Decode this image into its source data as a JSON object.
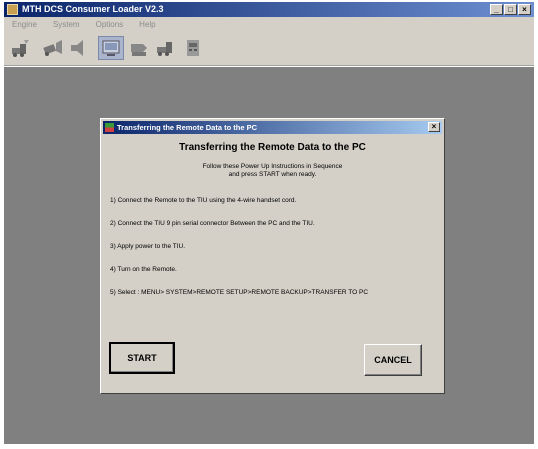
{
  "app": {
    "title": "MTH DCS Consumer Loader V2.3",
    "window_controls": [
      "_",
      "□",
      "×"
    ]
  },
  "menu": {
    "items": [
      "Engine",
      "System",
      "Options",
      "Help"
    ]
  },
  "toolbar": {
    "buttons": [
      "engine-load-icon",
      "engine-sounds-icon",
      "remote-transfer-icon",
      "tiu-load-icon",
      "power-pc-icon",
      "remote-icon"
    ]
  },
  "dialog": {
    "title": "Transferring the Remote Data to the PC",
    "close_label": "×",
    "heading": "Transferring the Remote Data to the PC",
    "intro_line1": "Follow these Power Up Instructions in Sequence",
    "intro_line2": "and press START when ready.",
    "steps": [
      "1)  Connect the Remote to the TIU using the 4-wire handset cord.",
      "2)  Connect the TIU 9 pin serial connector Between the PC and the TIU.",
      "3)  Apply power to the TIU.",
      "4)  Turn on the Remote.",
      "5)  Select : MENU> SYSTEM>REMOTE SETUP>REMOTE BACKUP>TRANSFER TO PC"
    ],
    "start_label": "START",
    "cancel_label": "CANCEL"
  }
}
